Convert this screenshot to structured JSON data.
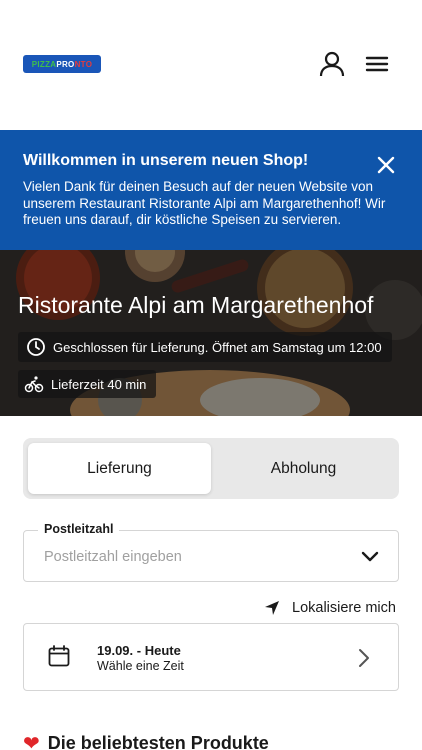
{
  "header": {
    "logo": {
      "part1": "PIZZA",
      "part2": "PRO",
      "part3": "NTO"
    },
    "icons": {
      "account": "user-icon",
      "menu": "hamburger-menu-icon"
    }
  },
  "banner": {
    "title": "Willkommen in unserem neuen Shop!",
    "text": "Vielen Dank für deinen Besuch auf der neuen Website von unserem Restaurant Ristorante Alpi am Margarethenhof! Wir freuen uns darauf, dir köstliche Speisen zu servieren.",
    "close_icon": "close-icon",
    "color": "#0f55aa"
  },
  "hero": {
    "restaurant_name": "Ristorante Alpi am Margarethenhof",
    "status": "Geschlossen für Lieferung. Öffnet am Samstag um 12:00",
    "delivery_time": "Lieferzeit 40 min",
    "icons": {
      "status": "clock-icon",
      "delivery": "bicycle-icon"
    }
  },
  "order_mode": {
    "options": [
      "Lieferung",
      "Abholung"
    ],
    "selected": "Lieferung"
  },
  "postcode": {
    "label": "Postleitzahl",
    "placeholder": "Postleitzahl eingeben",
    "value": ""
  },
  "locate": {
    "label": "Lokalisiere mich",
    "icon": "location-arrow-icon"
  },
  "schedule": {
    "date": "19.09. - Heute",
    "hint": "Wähle eine Zeit",
    "icon": "calendar-icon"
  },
  "popular": {
    "title": "Die beliebtesten Produkte",
    "icon": "heart-icon"
  }
}
